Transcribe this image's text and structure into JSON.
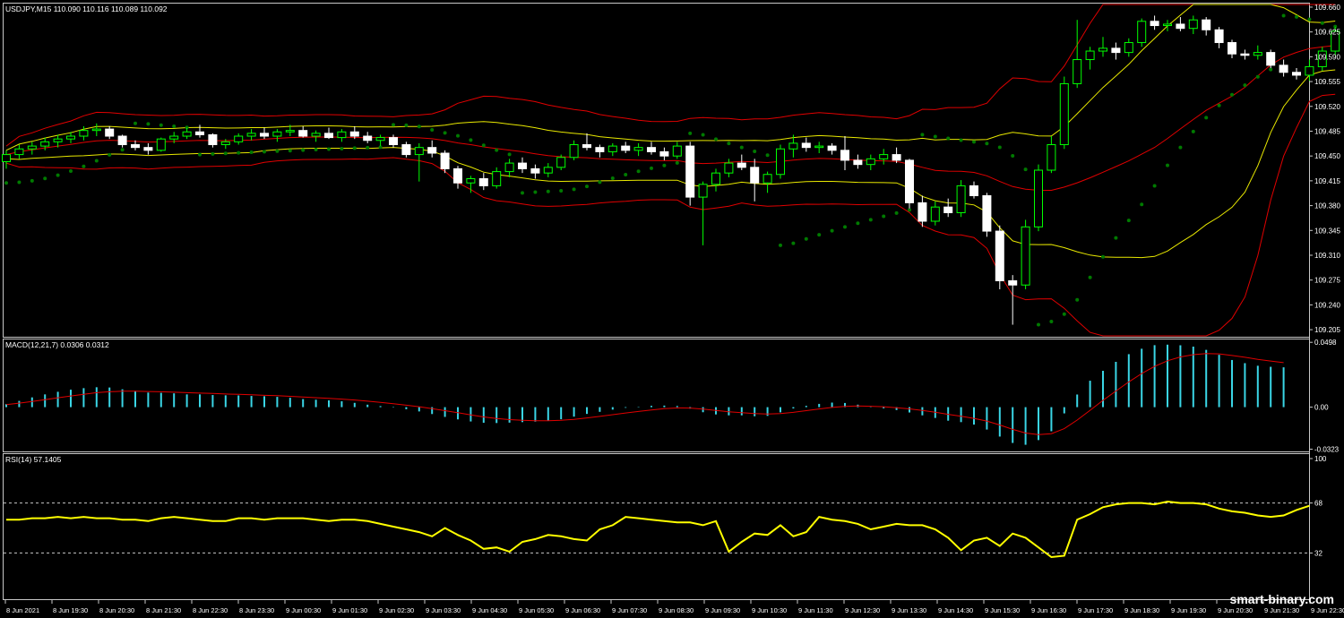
{
  "symbol_header": "USDJPY,M15  110.090 110.116 110.089 110.092",
  "watermark": "smart-binary.com",
  "colors": {
    "background": "#000000",
    "frame": "#c8c8c8",
    "text": "#ffffff",
    "bull_candle": "#00ff00",
    "bear_candle": "#ffffff",
    "bollinger_outer": "#e00000",
    "bollinger_inner": "#e8e800",
    "parabolic_sar": "#007a00",
    "macd_histogram": "#3ad6e6",
    "macd_signal": "#e00000",
    "rsi_line": "#ffff00",
    "rsi_levels": "#c8c8c8"
  },
  "price_panel": {
    "axis_labels": [
      "109.660",
      "109.625",
      "109.590",
      "109.555",
      "109.520",
      "109.485",
      "109.450",
      "109.415",
      "109.380",
      "109.345",
      "109.310",
      "109.275",
      "109.240",
      "109.205"
    ],
    "y_range": [
      109.195,
      109.665
    ]
  },
  "macd_panel": {
    "header": "MACD(12,21,7) 0.0306 0.0312",
    "axis_labels": [
      "0.0498",
      "0.00",
      "-0.0323"
    ],
    "y_range": [
      -0.034,
      0.052
    ]
  },
  "rsi_panel": {
    "header": "RSI(14) 57.1405",
    "axis_labels": [
      "100",
      "68",
      "32"
    ],
    "levels": [
      68,
      32
    ]
  },
  "time_axis": [
    "8 Jun 2021",
    "8 Jun 19:30",
    "8 Jun 20:30",
    "8 Jun 21:30",
    "8 Jun 22:30",
    "8 Jun 23:30",
    "9 Jun 00:30",
    "9 Jun 01:30",
    "9 Jun 02:30",
    "9 Jun 03:30",
    "9 Jun 04:30",
    "9 Jun 05:30",
    "9 Jun 06:30",
    "9 Jun 07:30",
    "9 Jun 08:30",
    "9 Jun 09:30",
    "9 Jun 10:30",
    "9 Jun 11:30",
    "9 Jun 12:30",
    "9 Jun 13:30",
    "9 Jun 14:30",
    "9 Jun 15:30",
    "9 Jun 16:30",
    "9 Jun 17:30",
    "9 Jun 18:30",
    "9 Jun 19:30",
    "9 Jun 20:30",
    "9 Jun 21:30",
    "9 Jun 22:30"
  ],
  "chart_data": [
    {
      "type": "candlestick",
      "symbol": "USDJPY",
      "timeframe": "M15",
      "ohlc": [
        [
          109.442,
          109.458,
          109.432,
          109.452
        ],
        [
          109.452,
          109.466,
          109.446,
          109.46
        ],
        [
          109.46,
          109.47,
          109.452,
          109.464
        ],
        [
          109.464,
          109.476,
          109.458,
          109.47
        ],
        [
          109.47,
          109.48,
          109.462,
          109.474
        ],
        [
          109.474,
          109.484,
          109.468,
          109.478
        ],
        [
          109.478,
          109.492,
          109.472,
          109.486
        ],
        [
          109.486,
          109.496,
          109.478,
          109.488
        ],
        [
          109.488,
          109.492,
          109.474,
          109.478
        ],
        [
          109.478,
          109.48,
          109.462,
          109.466
        ],
        [
          109.466,
          109.472,
          109.458,
          109.462
        ],
        [
          109.462,
          109.468,
          109.452,
          109.458
        ],
        [
          109.458,
          109.476,
          109.456,
          109.474
        ],
        [
          109.474,
          109.484,
          109.468,
          109.478
        ],
        [
          109.478,
          109.49,
          109.474,
          109.484
        ],
        [
          109.484,
          109.494,
          109.476,
          109.48
        ],
        [
          109.48,
          109.482,
          109.462,
          109.466
        ],
        [
          109.466,
          109.474,
          109.46,
          109.47
        ],
        [
          109.47,
          109.482,
          109.466,
          109.478
        ],
        [
          109.478,
          109.488,
          109.472,
          109.482
        ],
        [
          109.482,
          109.49,
          109.474,
          109.478
        ],
        [
          109.478,
          109.488,
          109.47,
          109.484
        ],
        [
          109.484,
          109.494,
          109.478,
          109.486
        ],
        [
          109.486,
          109.492,
          109.476,
          109.478
        ],
        [
          109.478,
          109.486,
          109.47,
          109.482
        ],
        [
          109.482,
          109.49,
          109.474,
          109.476
        ],
        [
          109.476,
          109.488,
          109.47,
          109.484
        ],
        [
          109.484,
          109.492,
          109.474,
          109.478
        ],
        [
          109.478,
          109.484,
          109.468,
          109.472
        ],
        [
          109.472,
          109.48,
          109.464,
          109.476
        ],
        [
          109.476,
          109.48,
          109.462,
          109.466
        ],
        [
          109.466,
          109.47,
          109.448,
          109.452
        ],
        [
          109.452,
          109.468,
          109.414,
          109.462
        ],
        [
          109.462,
          109.472,
          109.448,
          109.454
        ],
        [
          109.454,
          109.458,
          109.426,
          109.432
        ],
        [
          109.432,
          109.436,
          109.404,
          109.412
        ],
        [
          109.412,
          109.422,
          109.398,
          109.418
        ],
        [
          109.418,
          109.426,
          109.402,
          109.408
        ],
        [
          109.408,
          109.434,
          109.404,
          109.428
        ],
        [
          109.428,
          109.446,
          109.42,
          109.44
        ],
        [
          109.44,
          109.448,
          109.426,
          109.432
        ],
        [
          109.432,
          109.438,
          109.418,
          109.426
        ],
        [
          109.426,
          109.44,
          109.42,
          109.434
        ],
        [
          109.434,
          109.452,
          109.43,
          109.448
        ],
        [
          109.448,
          109.472,
          109.444,
          109.466
        ],
        [
          109.466,
          109.482,
          109.458,
          109.462
        ],
        [
          109.462,
          109.466,
          109.448,
          109.456
        ],
        [
          109.456,
          109.468,
          109.45,
          109.464
        ],
        [
          109.464,
          109.47,
          109.454,
          109.458
        ],
        [
          109.458,
          109.468,
          109.45,
          109.462
        ],
        [
          109.462,
          109.47,
          109.452,
          109.456
        ],
        [
          109.456,
          109.462,
          109.444,
          109.45
        ],
        [
          109.45,
          109.47,
          109.446,
          109.464
        ],
        [
          109.464,
          109.47,
          109.38,
          109.392
        ],
        [
          109.392,
          109.414,
          109.324,
          109.41
        ],
        [
          109.41,
          109.432,
          109.4,
          109.426
        ],
        [
          109.426,
          109.446,
          109.42,
          109.44
        ],
        [
          109.44,
          109.452,
          109.43,
          109.434
        ],
        [
          109.434,
          109.446,
          109.386,
          109.412
        ],
        [
          109.412,
          109.428,
          109.398,
          109.424
        ],
        [
          109.424,
          109.466,
          109.418,
          109.46
        ],
        [
          109.46,
          109.48,
          109.448,
          109.468
        ],
        [
          109.468,
          109.476,
          109.456,
          109.462
        ],
        [
          109.462,
          109.47,
          109.454,
          109.464
        ],
        [
          109.464,
          109.468,
          109.452,
          109.458
        ],
        [
          109.458,
          109.478,
          109.43,
          109.444
        ],
        [
          109.444,
          109.452,
          109.432,
          109.438
        ],
        [
          109.438,
          109.452,
          109.43,
          109.446
        ],
        [
          109.446,
          109.46,
          109.438,
          109.452
        ],
        [
          109.452,
          109.462,
          109.44,
          109.444
        ],
        [
          109.444,
          109.446,
          109.376,
          109.384
        ],
        [
          109.384,
          109.394,
          109.35,
          109.358
        ],
        [
          109.358,
          109.386,
          109.352,
          109.378
        ],
        [
          109.378,
          109.39,
          109.364,
          109.37
        ],
        [
          109.37,
          109.416,
          109.364,
          109.408
        ],
        [
          109.408,
          109.414,
          109.39,
          109.394
        ],
        [
          109.394,
          109.398,
          109.336,
          109.344
        ],
        [
          109.344,
          109.352,
          109.262,
          109.274
        ],
        [
          109.274,
          109.282,
          109.212,
          109.268
        ],
        [
          109.268,
          109.36,
          109.262,
          109.35
        ],
        [
          109.35,
          109.438,
          109.344,
          109.43
        ],
        [
          109.43,
          109.478,
          109.426,
          109.466
        ],
        [
          109.466,
          109.562,
          109.46,
          109.552
        ],
        [
          109.552,
          109.642,
          109.546,
          109.586
        ],
        [
          109.586,
          109.604,
          109.572,
          109.598
        ],
        [
          109.598,
          109.618,
          109.59,
          109.602
        ],
        [
          109.602,
          109.61,
          109.586,
          109.596
        ],
        [
          109.596,
          109.616,
          109.59,
          109.61
        ],
        [
          109.61,
          109.644,
          109.604,
          109.64
        ],
        [
          109.64,
          109.648,
          109.628,
          109.634
        ],
        [
          109.634,
          109.642,
          109.626,
          109.636
        ],
        [
          109.636,
          109.646,
          109.626,
          109.63
        ],
        [
          109.63,
          109.648,
          109.622,
          109.642
        ],
        [
          109.642,
          109.646,
          109.62,
          109.628
        ],
        [
          109.628,
          109.632,
          109.602,
          109.61
        ],
        [
          109.61,
          109.614,
          109.588,
          109.594
        ],
        [
          109.594,
          109.6,
          109.586,
          109.592
        ],
        [
          109.592,
          109.606,
          109.586,
          109.596
        ],
        [
          109.596,
          109.6,
          109.574,
          109.578
        ],
        [
          109.578,
          109.586,
          109.562,
          109.568
        ],
        [
          109.568,
          109.574,
          109.558,
          109.564
        ],
        [
          109.564,
          109.586,
          109.556,
          109.576
        ],
        [
          109.576,
          109.604,
          109.57,
          109.598
        ],
        [
          109.598,
          109.632,
          109.592,
          109.626
        ]
      ]
    },
    {
      "type": "bar",
      "name": "MACD(12,21,7)",
      "values": [
        0.0023,
        0.0048,
        0.0075,
        0.0098,
        0.0118,
        0.0134,
        0.0146,
        0.0153,
        0.0151,
        0.0137,
        0.0121,
        0.0112,
        0.011,
        0.0106,
        0.0098,
        0.0098,
        0.0093,
        0.0091,
        0.009,
        0.0086,
        0.0084,
        0.0079,
        0.0072,
        0.0062,
        0.0057,
        0.0052,
        0.0045,
        0.0033,
        0.0019,
        0.0008,
        -0.0003,
        -0.0016,
        -0.0033,
        -0.0053,
        -0.0075,
        -0.0094,
        -0.011,
        -0.012,
        -0.0122,
        -0.0119,
        -0.0115,
        -0.0111,
        -0.0104,
        -0.0093,
        -0.0073,
        -0.0052,
        -0.0036,
        -0.0019,
        -0.0005,
        0.0003,
        0.001,
        0.0012,
        0.0009,
        -0.0011,
        -0.0039,
        -0.0056,
        -0.0063,
        -0.0063,
        -0.007,
        -0.0067,
        -0.004,
        -0.001,
        0.001,
        0.0025,
        0.0035,
        0.0032,
        0.0019,
        0.0003,
        -0.0009,
        -0.0022,
        -0.0041,
        -0.0063,
        -0.0083,
        -0.0104,
        -0.0115,
        -0.0134,
        -0.0172,
        -0.0226,
        -0.0275,
        -0.0289,
        -0.0253,
        -0.0185,
        -0.0048,
        0.0097,
        0.0203,
        0.0279,
        0.0348,
        0.0407,
        0.0449,
        0.0476,
        0.048,
        0.0475,
        0.0465,
        0.044,
        0.0402,
        0.0362,
        0.0338,
        0.0318,
        0.031,
        0.0306
      ]
    },
    {
      "type": "line",
      "name": "MACD signal",
      "values": [
        0.002,
        0.0031,
        0.0044,
        0.0058,
        0.0072,
        0.0086,
        0.0099,
        0.0111,
        0.0118,
        0.0122,
        0.0122,
        0.012,
        0.0118,
        0.0115,
        0.0111,
        0.0108,
        0.0105,
        0.0101,
        0.0098,
        0.0095,
        0.0091,
        0.0088,
        0.0083,
        0.0078,
        0.0073,
        0.0068,
        0.0062,
        0.0055,
        0.0046,
        0.0036,
        0.0026,
        0.0015,
        0.0003,
        -0.0011,
        -0.0027,
        -0.0043,
        -0.006,
        -0.0075,
        -0.0087,
        -0.0096,
        -0.0101,
        -0.0104,
        -0.0104,
        -0.0101,
        -0.0094,
        -0.0083,
        -0.0071,
        -0.0058,
        -0.0045,
        -0.0033,
        -0.0022,
        -0.0012,
        -0.0006,
        -0.0007,
        -0.0015,
        -0.0025,
        -0.0035,
        -0.0042,
        -0.0049,
        -0.0053,
        -0.005,
        -0.004,
        -0.0027,
        -0.0014,
        -0.0002,
        0.0006,
        0.0009,
        0.0007,
        0.0003,
        -0.0004,
        -0.0013,
        -0.0025,
        -0.0039,
        -0.0055,
        -0.007,
        -0.0086,
        -0.0107,
        -0.0137,
        -0.0171,
        -0.0199,
        -0.0211,
        -0.0204,
        -0.0165,
        -0.0099,
        -0.0024,
        0.0052,
        0.0124,
        0.0194,
        0.0258,
        0.0313,
        0.0356,
        0.0386,
        0.0403,
        0.0412,
        0.0409,
        0.0397,
        0.0383,
        0.0367,
        0.0354,
        0.0342
      ]
    },
    {
      "type": "line",
      "name": "RSI(14)",
      "values": [
        56,
        56,
        57,
        57,
        58,
        57,
        58,
        57,
        57,
        56,
        56,
        55,
        57,
        58,
        57,
        56,
        55,
        55,
        57,
        57,
        56,
        57,
        57,
        57,
        56,
        55,
        56,
        56,
        55,
        53,
        51,
        49,
        47,
        44,
        50,
        45,
        41,
        35,
        36,
        33,
        40,
        42,
        45,
        44,
        42,
        41,
        49,
        52,
        58,
        57,
        56,
        55,
        54,
        54,
        52,
        55,
        33,
        40,
        46,
        45,
        52,
        44,
        47,
        58,
        56,
        55,
        53,
        49,
        51,
        53,
        52,
        52,
        49,
        43,
        34,
        41,
        43,
        37,
        46,
        43,
        36,
        29,
        30,
        56,
        60,
        65,
        67,
        68,
        68,
        67,
        69,
        68,
        68,
        67,
        64,
        62,
        61,
        59,
        58,
        59,
        63,
        66
      ]
    }
  ]
}
